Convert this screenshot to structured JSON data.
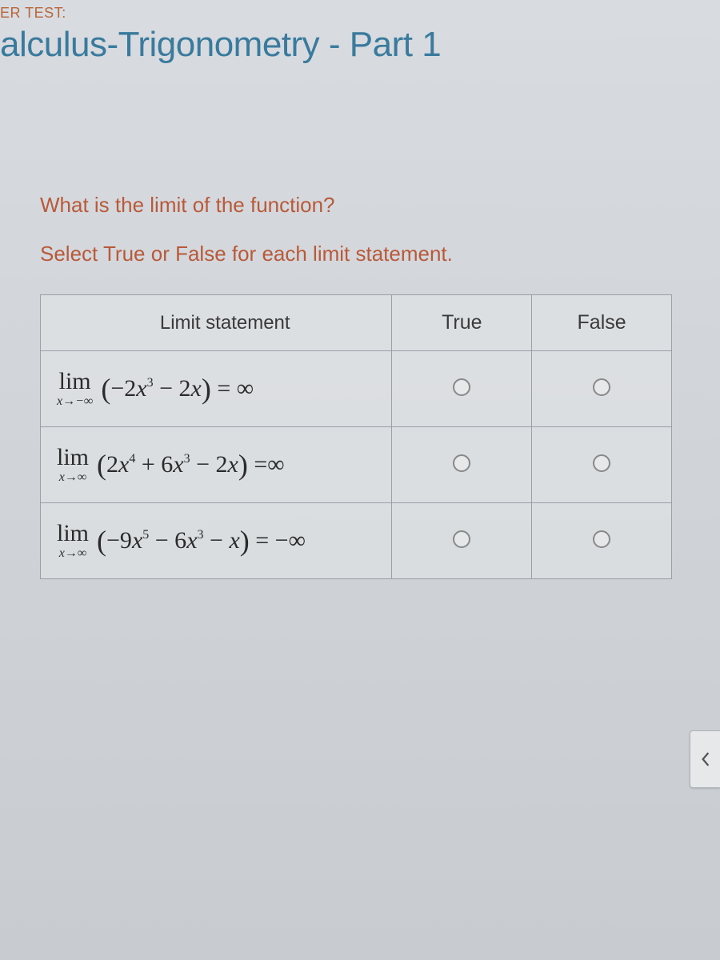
{
  "header": {
    "topLabel": "ER TEST:",
    "title": "alculus-Trigonometry - Part 1"
  },
  "question": {
    "prompt": "What is the limit of the function?",
    "instruction": "Select True or False for each limit statement."
  },
  "table": {
    "headers": {
      "statement": "Limit statement",
      "true": "True",
      "false": "False"
    },
    "rows": [
      {
        "approach": "x→−∞",
        "expression": "(−2x³ − 2x)",
        "result": "= ∞"
      },
      {
        "approach": "x→∞",
        "expression": "(2x⁴ + 6x³ − 2x)",
        "result": "=∞"
      },
      {
        "approach": "x→∞",
        "expression": "(−9x⁵ − 6x³ − x)",
        "result": "= −∞"
      }
    ]
  },
  "limWord": "lim"
}
